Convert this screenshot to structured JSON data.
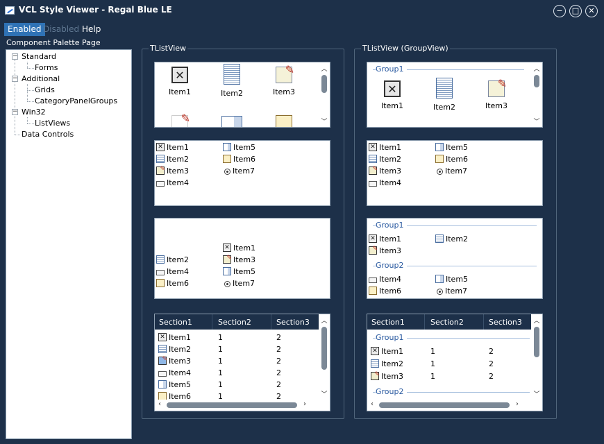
{
  "window": {
    "title": "VCL Style Viewer - Regal Blue LE",
    "minimize": "−",
    "maximize": "□",
    "close": "✕"
  },
  "menu": {
    "enabled": "Enabled",
    "disabled": "Disabled",
    "help": "Help"
  },
  "palette": {
    "label": "Component Palette Page",
    "nodes": [
      {
        "label": "Standard",
        "expander": "−"
      },
      {
        "label": "Forms"
      },
      {
        "label": "Additional",
        "expander": "−"
      },
      {
        "label": "Grids"
      },
      {
        "label": "CategoryPanelGroups"
      },
      {
        "label": "Win32",
        "expander": "−"
      },
      {
        "label": "ListViews"
      },
      {
        "label": "Data Controls"
      }
    ]
  },
  "left_group": {
    "title": "TListView"
  },
  "right_group": {
    "title": "TListView (GroupView)"
  },
  "items": [
    "Item1",
    "Item2",
    "Item3",
    "Item4",
    "Item5",
    "Item6",
    "Item7"
  ],
  "groups": [
    "Group1",
    "Group2"
  ],
  "columns": [
    "Section1",
    "Section2",
    "Section3"
  ],
  "rows": [
    {
      "label": "Item1",
      "c2": "1",
      "c3": "2"
    },
    {
      "label": "Item2",
      "c2": "1",
      "c3": "2"
    },
    {
      "label": "Item3",
      "c2": "1",
      "c3": "2"
    },
    {
      "label": "Item4",
      "c2": "1",
      "c3": "2"
    },
    {
      "label": "Item5",
      "c2": "1",
      "c3": "2"
    },
    {
      "label": "Item6",
      "c2": "1",
      "c3": "2"
    }
  ],
  "arrows": {
    "up": "︿",
    "down": "﹀",
    "left": "‹",
    "right": "›"
  },
  "icons": {
    "item1": "x-box-icon",
    "item2": "list-icon",
    "item3": "edit-icon",
    "item4": "label-icon",
    "item5": "listbox-icon",
    "item6": "memo-icon",
    "item7": "radio-icon"
  }
}
